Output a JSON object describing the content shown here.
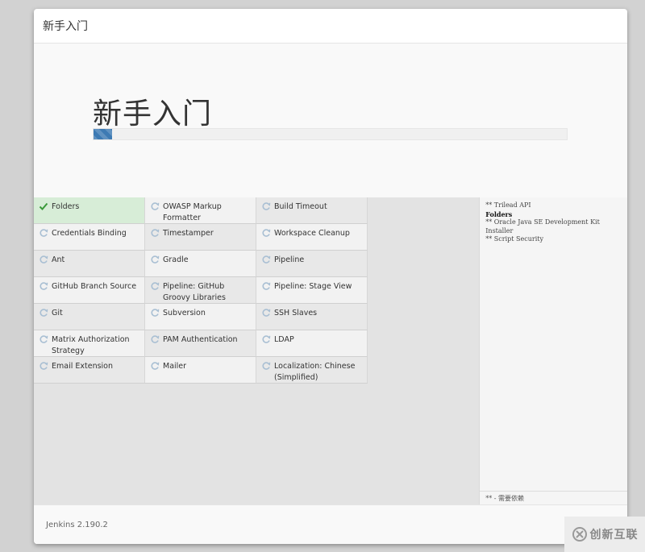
{
  "dialog": {
    "header_title": "新手入门",
    "hero_title": "新手入门",
    "progress_fraction": 0.04,
    "accent_color": "#3d7ab3"
  },
  "plugins": [
    {
      "label": "Folders",
      "status": "installed",
      "icon": "check-icon"
    },
    {
      "label": "OWASP Markup Formatter",
      "status": "pending",
      "icon": "refresh-icon"
    },
    {
      "label": "Build Timeout",
      "status": "pending",
      "icon": "refresh-icon"
    },
    {
      "label": "Credentials Binding",
      "status": "pending",
      "icon": "refresh-icon"
    },
    {
      "label": "Timestamper",
      "status": "pending",
      "icon": "refresh-icon"
    },
    {
      "label": "Workspace Cleanup",
      "status": "pending",
      "icon": "refresh-icon"
    },
    {
      "label": "Ant",
      "status": "pending",
      "icon": "refresh-icon"
    },
    {
      "label": "Gradle",
      "status": "pending",
      "icon": "refresh-icon"
    },
    {
      "label": "Pipeline",
      "status": "pending",
      "icon": "refresh-icon"
    },
    {
      "label": "GitHub Branch Source",
      "status": "pending",
      "icon": "refresh-icon"
    },
    {
      "label": "Pipeline: GitHub Groovy Libraries",
      "status": "pending",
      "icon": "refresh-icon"
    },
    {
      "label": "Pipeline: Stage View",
      "status": "pending",
      "icon": "refresh-icon"
    },
    {
      "label": "Git",
      "status": "pending",
      "icon": "refresh-icon"
    },
    {
      "label": "Subversion",
      "status": "pending",
      "icon": "refresh-icon"
    },
    {
      "label": "SSH Slaves",
      "status": "pending",
      "icon": "refresh-icon"
    },
    {
      "label": "Matrix Authorization Strategy",
      "status": "pending",
      "icon": "refresh-icon"
    },
    {
      "label": "PAM Authentication",
      "status": "pending",
      "icon": "refresh-icon"
    },
    {
      "label": "LDAP",
      "status": "pending",
      "icon": "refresh-icon"
    },
    {
      "label": "Email Extension",
      "status": "pending",
      "icon": "refresh-icon"
    },
    {
      "label": "Mailer",
      "status": "pending",
      "icon": "refresh-icon"
    },
    {
      "label": "Localization: Chinese (Simplified)",
      "status": "pending",
      "icon": "refresh-icon"
    }
  ],
  "log": {
    "lines": [
      {
        "text": "** Trilead API",
        "strong": false
      },
      {
        "text": "Folders",
        "strong": true
      },
      {
        "text": "** Oracle Java SE Development Kit Installer",
        "strong": false
      },
      {
        "text": "** Script Security",
        "strong": false
      }
    ],
    "footer": "** - 需要依赖"
  },
  "footer": {
    "version": "Jenkins 2.190.2"
  },
  "watermark": {
    "text": "创新互联"
  }
}
